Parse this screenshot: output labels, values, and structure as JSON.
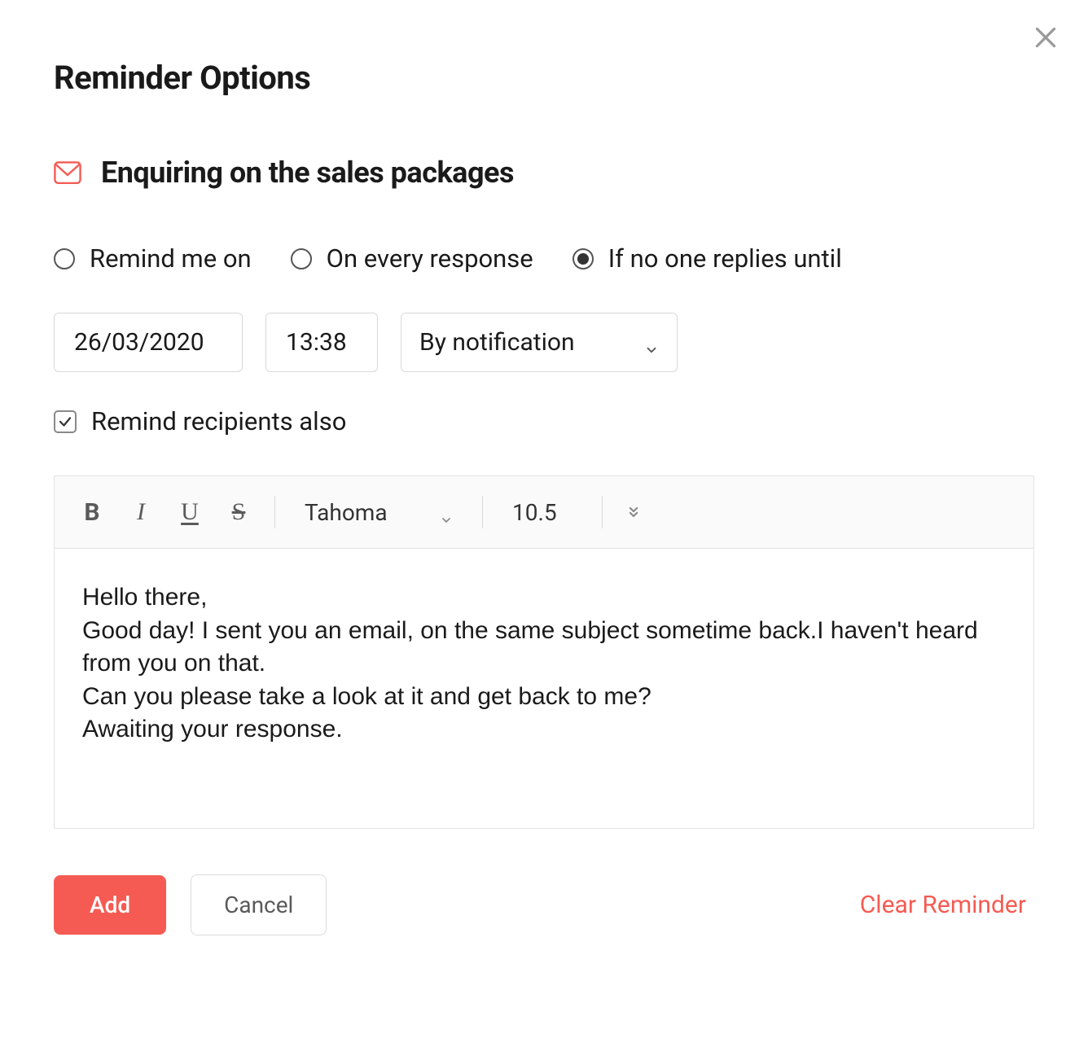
{
  "title": "Reminder Options",
  "subject": "Enquiring on the sales packages",
  "radios": {
    "remind_on": "Remind me on",
    "every_response": "On every response",
    "no_reply": "If no one replies until",
    "selected": "no_reply"
  },
  "inputs": {
    "date": "26/03/2020",
    "time": "13:38",
    "method": "By notification"
  },
  "checkbox": {
    "recipients_label": "Remind recipients also",
    "recipients_checked": true
  },
  "toolbar": {
    "font": "Tahoma",
    "size": "10.5"
  },
  "message": {
    "line1": "Hello there,",
    "line2": "Good day! I sent you an email, on the same subject sometime back.I haven't heard from you on that.",
    "line3": "Can you please take a look at it and get back to me?",
    "line4": "Awaiting your response."
  },
  "buttons": {
    "add": "Add",
    "cancel": "Cancel",
    "clear": "Clear Reminder"
  }
}
